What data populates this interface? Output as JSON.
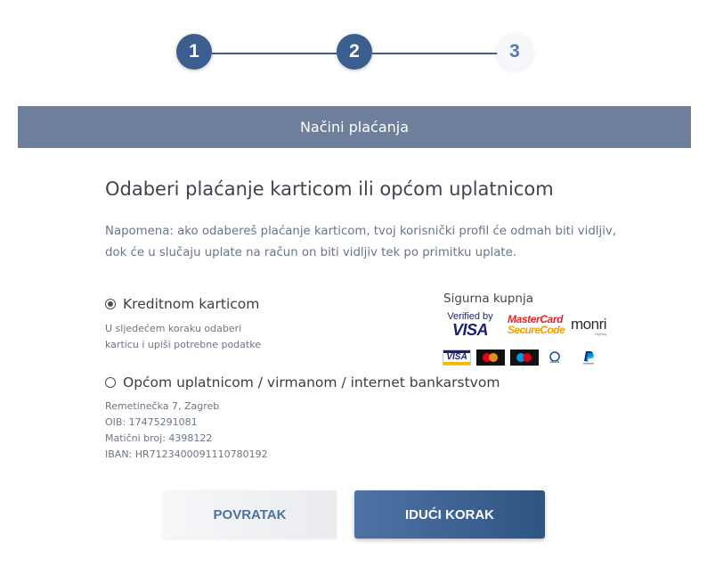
{
  "stepper": {
    "steps": [
      {
        "number": "1",
        "state": "completed"
      },
      {
        "number": "2",
        "state": "completed"
      },
      {
        "number": "3",
        "state": "current"
      }
    ],
    "colors": {
      "active": "#3b5e8f",
      "inactive_text": "#5579a8"
    }
  },
  "section_bar": {
    "title": "Načini plaćanja",
    "color": "#6d7f9a"
  },
  "main": {
    "heading": "Odaberi plaćanje karticom ili općom uplatnicom",
    "note": "Napomena: ako odabereš plaćanje karticom, tvoj korisnički profil će odmah biti vidljiv, dok će u slučaju uplate na račun on biti vidljiv tek po primitku uplate."
  },
  "options": {
    "card": {
      "label": "Kreditnom karticom",
      "selected": true,
      "hint_line1": "U sljedećem koraku odaberi",
      "hint_line2": "karticu i upiši potrebne podatke"
    },
    "slip": {
      "label": "Općom uplatnicom / virmanom / internet bankarstvom",
      "selected": false,
      "address": "Remetinečka 7, Zagreb",
      "oib": "OIB: 17475291081",
      "mb": "Matični broj: 4398122",
      "iban": "IBAN: HR7123400091110780192"
    }
  },
  "secure": {
    "title": "Sigurna kupnja",
    "verified_by": "Verified by",
    "visa": "VISA",
    "mastercard": "MasterCard",
    "securecode": "SecureCode",
    "monri": "monri",
    "monri_sub": "Pay Easy",
    "card_visa": "VISA",
    "icons": [
      "visa-card-icon",
      "mastercard-icon",
      "maestro-icon",
      "diners-club-icon",
      "paypal-icon"
    ]
  },
  "buttons": {
    "back": "POVRATAK",
    "next": "IDUĆI KORAK"
  }
}
